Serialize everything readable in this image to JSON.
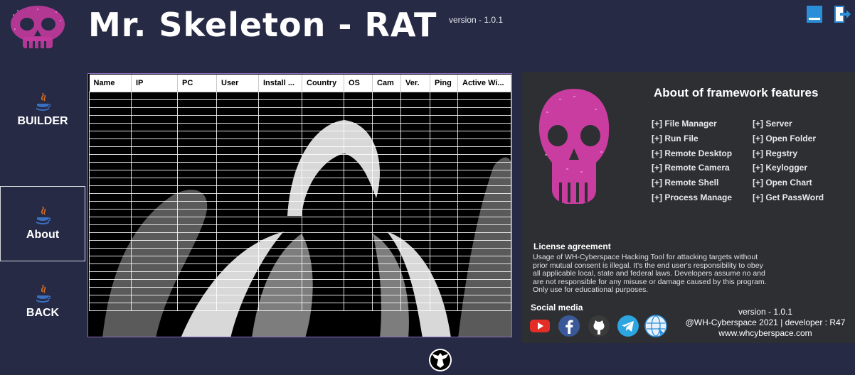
{
  "header": {
    "title": "Mr. Skeleton - RAT",
    "version": "version - 1.0.1",
    "logo_icon": "skull-icon",
    "minimize_icon": "minimize-icon",
    "exit_icon": "exit-icon"
  },
  "sidebar": {
    "items": [
      {
        "label": "BUILDER",
        "icon": "java-icon"
      },
      {
        "label": "About",
        "icon": "java-icon",
        "active": true
      },
      {
        "label": "BACK",
        "icon": "java-icon"
      }
    ]
  },
  "table": {
    "columns": [
      "Name",
      "IP",
      "PC",
      "User",
      "Install ...",
      "Country",
      "OS",
      "Cam",
      "Ver.",
      "Ping",
      "Active Wi..."
    ]
  },
  "about": {
    "title": "About of framework features",
    "features_left": [
      "[+] File Manager",
      "[+] Run File",
      "[+] Remote Desktop",
      "[+] Remote Camera",
      "[+] Remote Shell",
      "[+] Process Manage"
    ],
    "features_right": [
      "[+] Server",
      "[+] Open Folder",
      "[+] Regstry",
      "[+] Keylogger",
      "[+] Open Chart",
      "[+] Get PassWord"
    ],
    "license_title": "License agreement",
    "license_text": "Usage of WH-Cyberspace Hacking Tool for attacking targets without prior mutual consent is illegal. It's the end user's responsibility to obey all applicable local, state and federal laws. Developers assume no and are not responsible for any misuse or damage caused by this program. Only use for educational purposes.",
    "social_title": "Social media",
    "social_icons": [
      "youtube-icon",
      "facebook-icon",
      "github-icon",
      "telegram-icon",
      "website-icon"
    ],
    "version": "version - 1.0.1",
    "copyright": "@WH-Cyberspace 2021 | developer : R47",
    "website": "www.whcyberspace.com"
  },
  "colors": {
    "background": "#262a45",
    "panel": "#2e2f33",
    "accent_pink": "#d63fa8",
    "minimize_blue": "#2a8fd8"
  }
}
